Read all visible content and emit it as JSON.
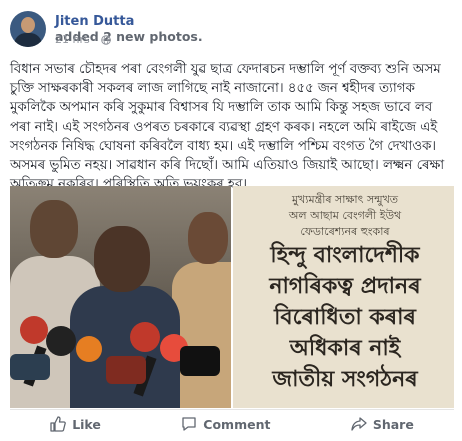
{
  "post": {
    "author": "Jiten Dutta",
    "action": "added 2 new photos.",
    "timestamp": "21 hrs",
    "dot": "·",
    "privacy_icon": "globe-icon",
    "text": "বিধান সভাৰ চৌহদৰ পৰা বেংগলী যুৱ ছাত্ৰ ফেদাৰচন দম্ভালি পূৰ্ণ বক্তব্য শুনি অসম চুক্তি সাক্ষৰকাৰী সকলৰ লাজ লাগিছে নাই নাজানো। ৪৫৫ জন শ্বহীদৰ ত্যাগক মুকলিকৈ অপমান কৰি সুকুমাৰ বিশ্বাসৰ যি দম্ভালি তাক আমি কিন্তু সহজ ভাবে লব পৰা নাই। এই সংগঠনৰ ওপৰত চৰকাৰে ব্যৱস্থা গ্ৰহণ কৰক। নহলে অমি ৰাইজে এই সংগঠনক নিষিদ্ধ ঘোষনা কৰিবলৈ বাধ্য হম। এই দম্ভালি পশ্চিম বংগত গৈ দেখাওক। অসমৰ ভুমিত নহয়। সাৱধান কৰি দিছোঁ। আমি এতিয়াও জিয়াই আছো। লক্ষ্মন ৰেক্ষা অতিক্ৰম নকৰিব। পৰিস্থিতি অতি ভয়ংকৰ হব।"
  },
  "photos": {
    "left": {
      "icon": "press-conference-photo"
    },
    "right": {
      "lines_small": [
        "মুখ্যমন্ত্ৰীৰ সাক্ষাৎ সন্মুখত",
        "অল আছাম বেংগলী ইউথ",
        "ফেডাৰেশ্যনৰ হুংকাৰ"
      ],
      "lines_big": [
        "হিন্দু বাংলাদেশীক",
        "নাগৰিকত্ব প্ৰদানৰ",
        "বিৰোধিতা কৰাৰ",
        "অধিকাৰ নাই",
        "জাতীয় সংগঠনৰ"
      ]
    }
  },
  "actions": {
    "like": "Like",
    "comment": "Comment",
    "share": "Share"
  },
  "colors": {
    "link": "#365899",
    "text": "#1d2129",
    "muted": "#90949c"
  }
}
